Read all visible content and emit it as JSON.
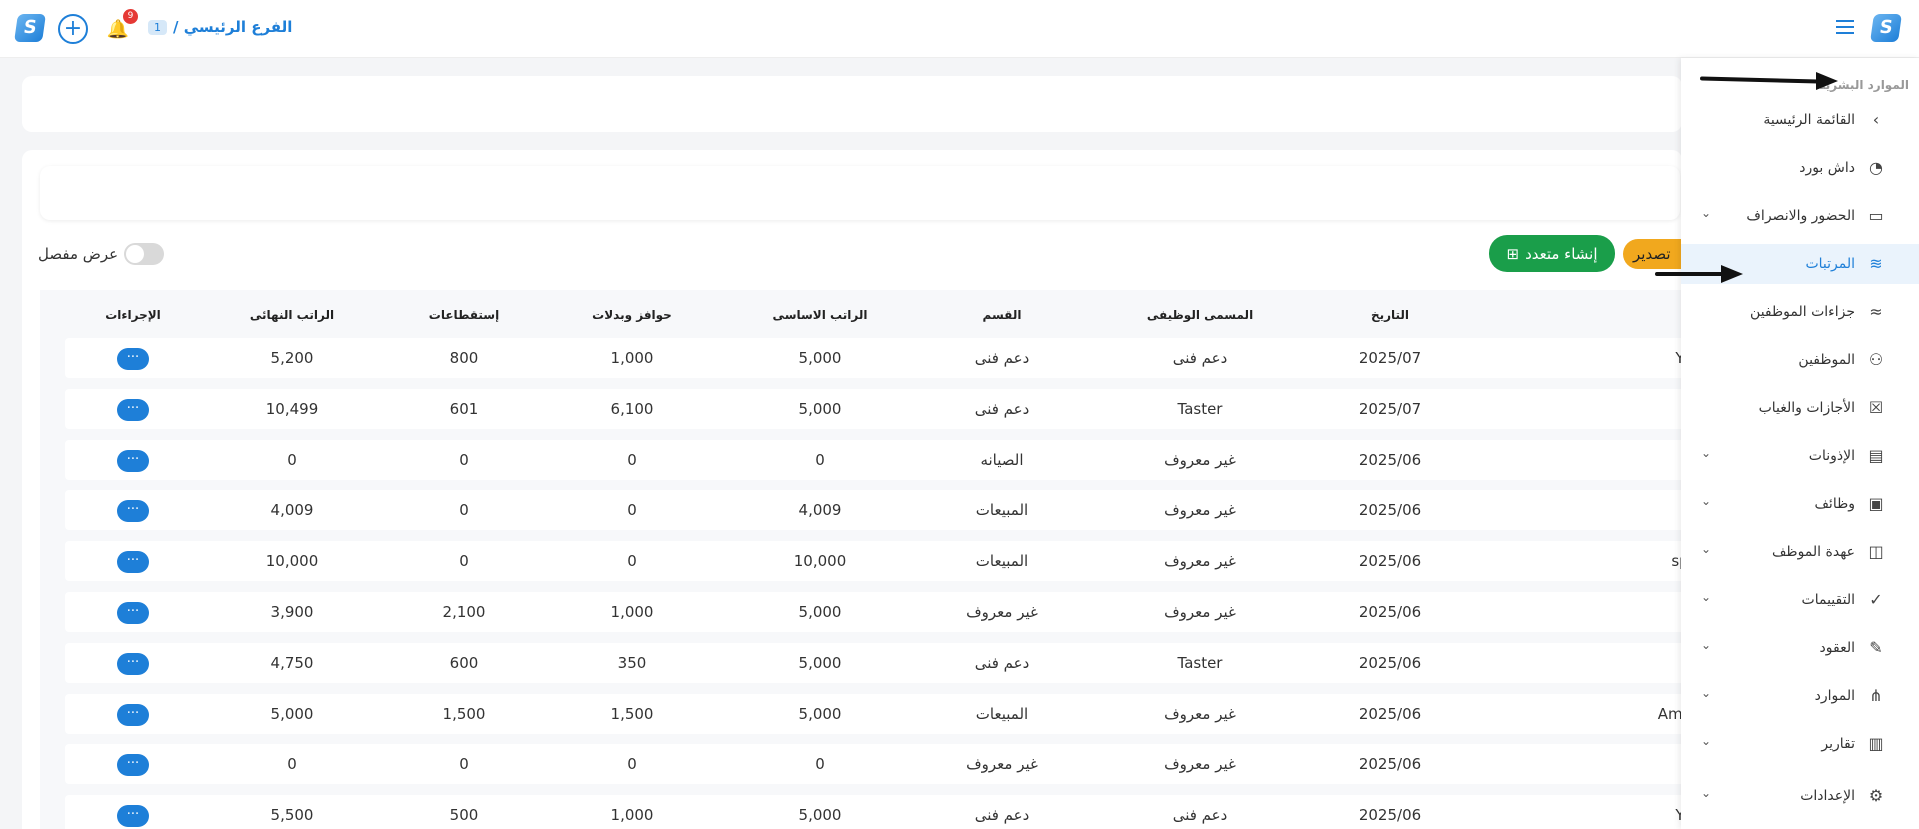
{
  "topbar": {
    "branch_label": "الفرع الرئيسي /",
    "branch_number": "1",
    "notification_count": "9",
    "logo_glyph": "S",
    "plus_glyph": "+",
    "bell_glyph": "🔔"
  },
  "toolbar": {
    "detailed_view_label": "عرض مفصل",
    "create_multiple_label": "إنشاء متعدد",
    "create_multiple_glyph": "⊞",
    "export_label": "تصدير"
  },
  "table": {
    "headers": {
      "date": "التاريخ",
      "job_title": "المسمى الوظيفى",
      "department": "القسم",
      "basic_salary": "الراتب الاساسى",
      "allowances": "حوافز وبدلات",
      "deductions": "إستقطاعات",
      "final_salary": "الراتب النهائى",
      "actions": "الإجراءات"
    },
    "action_glyph": "···",
    "rows": [
      {
        "name": "Y",
        "date": "2025/07",
        "job_title": "دعم فنى",
        "department": "دعم فنى",
        "basic": "5,000",
        "allowances": "1,000",
        "deductions": "800",
        "final": "5,200"
      },
      {
        "name": "",
        "date": "2025/07",
        "job_title": "Taster",
        "department": "دعم فنى",
        "basic": "5,000",
        "allowances": "6,100",
        "deductions": "601",
        "final": "10,499"
      },
      {
        "name": "",
        "date": "2025/06",
        "job_title": "غير معروف",
        "department": "الصيانه",
        "basic": "0",
        "allowances": "0",
        "deductions": "0",
        "final": "0"
      },
      {
        "name": "",
        "date": "2025/06",
        "job_title": "غير معروف",
        "department": "المبيعات",
        "basic": "4,009",
        "allowances": "0",
        "deductions": "0",
        "final": "4,009"
      },
      {
        "name": "sp",
        "date": "2025/06",
        "job_title": "غير معروف",
        "department": "المبيعات",
        "basic": "10,000",
        "allowances": "0",
        "deductions": "0",
        "final": "10,000"
      },
      {
        "name": "",
        "date": "2025/06",
        "job_title": "غير معروف",
        "department": "غير معروف",
        "basic": "5,000",
        "allowances": "1,000",
        "deductions": "2,100",
        "final": "3,900"
      },
      {
        "name": "",
        "date": "2025/06",
        "job_title": "Taster",
        "department": "دعم فنى",
        "basic": "5,000",
        "allowances": "350",
        "deductions": "600",
        "final": "4,750"
      },
      {
        "name": "Amira",
        "date": "2025/06",
        "job_title": "غير معروف",
        "department": "المبيعات",
        "basic": "5,000",
        "allowances": "1,500",
        "deductions": "1,500",
        "final": "5,000"
      },
      {
        "name": "",
        "date": "2025/06",
        "job_title": "غير معروف",
        "department": "غير معروف",
        "basic": "0",
        "allowances": "0",
        "deductions": "0",
        "final": "0"
      },
      {
        "name": "Y",
        "date": "2025/06",
        "job_title": "دعم فنى",
        "department": "دعم فنى",
        "basic": "5,000",
        "allowances": "1,000",
        "deductions": "500",
        "final": "5,500"
      }
    ]
  },
  "sidebar": {
    "section_title": "الموارد البشرية",
    "items": [
      {
        "label": "القائمة الرئيسية",
        "icon": "‹",
        "icon_name": "chevron-left-icon",
        "chevron": false,
        "active": false
      },
      {
        "label": "داش بورد",
        "icon": "◔",
        "icon_name": "gauge-icon",
        "chevron": false,
        "active": false
      },
      {
        "label": "الحضور والانصراف",
        "icon": "▭",
        "icon_name": "ticket-icon",
        "chevron": true,
        "active": false
      },
      {
        "label": "المرتبات",
        "icon": "≋",
        "icon_name": "payroll-icon",
        "chevron": false,
        "active": true
      },
      {
        "label": "جزاءات الموظفين",
        "icon": "≈",
        "icon_name": "penalty-icon",
        "chevron": false,
        "active": false
      },
      {
        "label": "الموظفين",
        "icon": "⚇",
        "icon_name": "users-gear-icon",
        "chevron": false,
        "active": false
      },
      {
        "label": "الأجازات والغياب",
        "icon": "☒",
        "icon_name": "calendar-x-icon",
        "chevron": false,
        "active": false
      },
      {
        "label": "الإذونات",
        "icon": "▤",
        "icon_name": "document-icon",
        "chevron": true,
        "active": false
      },
      {
        "label": "وظائف",
        "icon": "▣",
        "icon_name": "job-icon",
        "chevron": true,
        "active": false
      },
      {
        "label": "عهدة الموظف",
        "icon": "◫",
        "icon_name": "custody-icon",
        "chevron": true,
        "active": false
      },
      {
        "label": "التقييمات",
        "icon": "✓",
        "icon_name": "rating-icon",
        "chevron": true,
        "active": false
      },
      {
        "label": "العقود",
        "icon": "✎",
        "icon_name": "contract-icon",
        "chevron": true,
        "active": false
      },
      {
        "label": "الموارد",
        "icon": "⋔",
        "icon_name": "resources-icon",
        "chevron": true,
        "active": false
      },
      {
        "label": "تقارير",
        "icon": "▥",
        "icon_name": "reports-icon",
        "chevron": true,
        "active": false
      },
      {
        "label": "الإعدادات",
        "icon": "⚙",
        "icon_name": "gear-icon",
        "chevron": true,
        "active": false
      }
    ],
    "chevron_glyph": "⌄"
  }
}
